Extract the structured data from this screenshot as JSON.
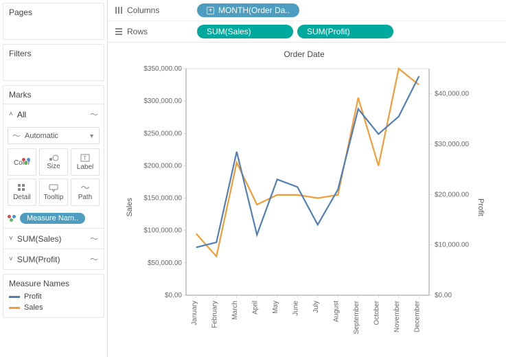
{
  "left": {
    "pages_title": "Pages",
    "filters_title": "Filters",
    "marks_title": "Marks",
    "all_label": "All",
    "mark_type": "Automatic",
    "slots": {
      "color": "Color",
      "size": "Size",
      "label": "Label",
      "detail": "Detail",
      "tooltip": "Tooltip",
      "path": "Path"
    },
    "color_pill": "Measure Nam..",
    "sum_sales": "SUM(Sales)",
    "sum_profit": "SUM(Profit)"
  },
  "legend": {
    "title": "Measure Names",
    "items": [
      {
        "label": "Profit",
        "color": "#4f7fb7"
      },
      {
        "label": "Sales",
        "color": "#f39c34"
      }
    ]
  },
  "shelves": {
    "columns_label": "Columns",
    "rows_label": "Rows",
    "columns_pill": "MONTH(Order Da..",
    "rows_pill_1": "SUM(Sales)",
    "rows_pill_2": "SUM(Profit)"
  },
  "viz": {
    "title": "Order Date",
    "left_axis_label": "Sales",
    "right_axis_label": "Profit"
  },
  "chart_data": {
    "type": "line",
    "title": "Order Date",
    "categories": [
      "January",
      "February",
      "March",
      "April",
      "May",
      "June",
      "July",
      "August",
      "September",
      "October",
      "November",
      "December"
    ],
    "series": [
      {
        "name": "Sales",
        "axis": "left",
        "color": "#f39c34",
        "values": [
          95000,
          60000,
          205000,
          140000,
          155000,
          155000,
          150000,
          155000,
          305000,
          200000,
          350000,
          325000
        ]
      },
      {
        "name": "Profit",
        "axis": "right",
        "color": "#4f7fb7",
        "values": [
          9500,
          10500,
          28500,
          12000,
          23000,
          21500,
          14000,
          21000,
          37000,
          32000,
          35500,
          43500
        ]
      }
    ],
    "left_axis": {
      "label": "Sales",
      "min": 0,
      "max": 350000,
      "ticks": [
        0,
        50000,
        100000,
        150000,
        200000,
        250000,
        300000,
        350000
      ],
      "tick_labels": [
        "$0.00",
        "$50,000.00",
        "$100,000.00",
        "$150,000.00",
        "$200,000.00",
        "$250,000.00",
        "$300,000.00",
        "$350,000.00"
      ]
    },
    "right_axis": {
      "label": "Profit",
      "min": 0,
      "max": 45000,
      "ticks": [
        0,
        10000,
        20000,
        30000,
        40000
      ],
      "tick_labels": [
        "$0.00",
        "$10,000.00",
        "$20,000.00",
        "$30,000.00",
        "$40,000.00"
      ]
    }
  }
}
